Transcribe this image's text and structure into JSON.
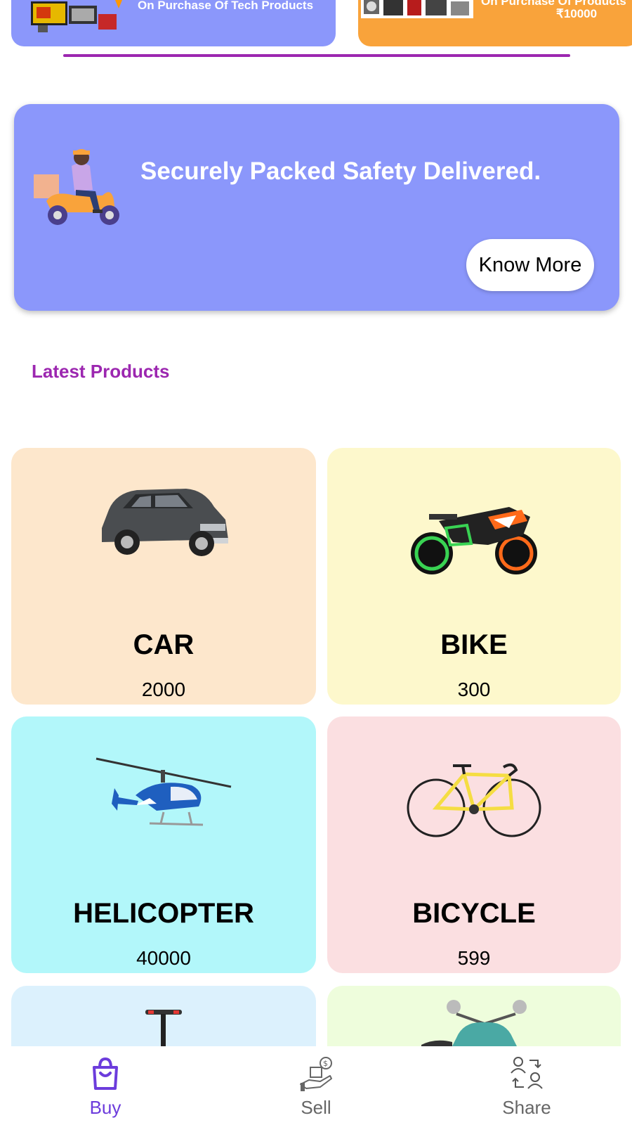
{
  "promos": [
    {
      "text": "On Purchase Of Tech Products"
    },
    {
      "line1": "On Purchase Of Products",
      "line2": "₹10000"
    }
  ],
  "banner": {
    "title": "Securely Packed Safety Delivered.",
    "button_label": "Know More"
  },
  "section": {
    "title": "Latest Products"
  },
  "products": [
    {
      "name": "CAR",
      "price": "2000",
      "bg": "#fde7cc"
    },
    {
      "name": "BIKE",
      "price": "300",
      "bg": "#fdf8cc"
    },
    {
      "name": "HELICOPTER",
      "price": "40000",
      "bg": "#b2f7fa"
    },
    {
      "name": "BICYCLE",
      "price": "599",
      "bg": "#fbdfe1"
    }
  ],
  "nav": {
    "items": [
      {
        "label": "Buy",
        "icon": "shopping-bag-icon",
        "active": true
      },
      {
        "label": "Sell",
        "icon": "sell-hand-icon",
        "active": false
      },
      {
        "label": "Share",
        "icon": "share-people-icon",
        "active": false
      }
    ]
  },
  "colors": {
    "accent": "#9c27b0",
    "banner_bg": "#8b97fb",
    "promo_orange": "#f9a33b",
    "nav_active": "#6c3cdc"
  }
}
